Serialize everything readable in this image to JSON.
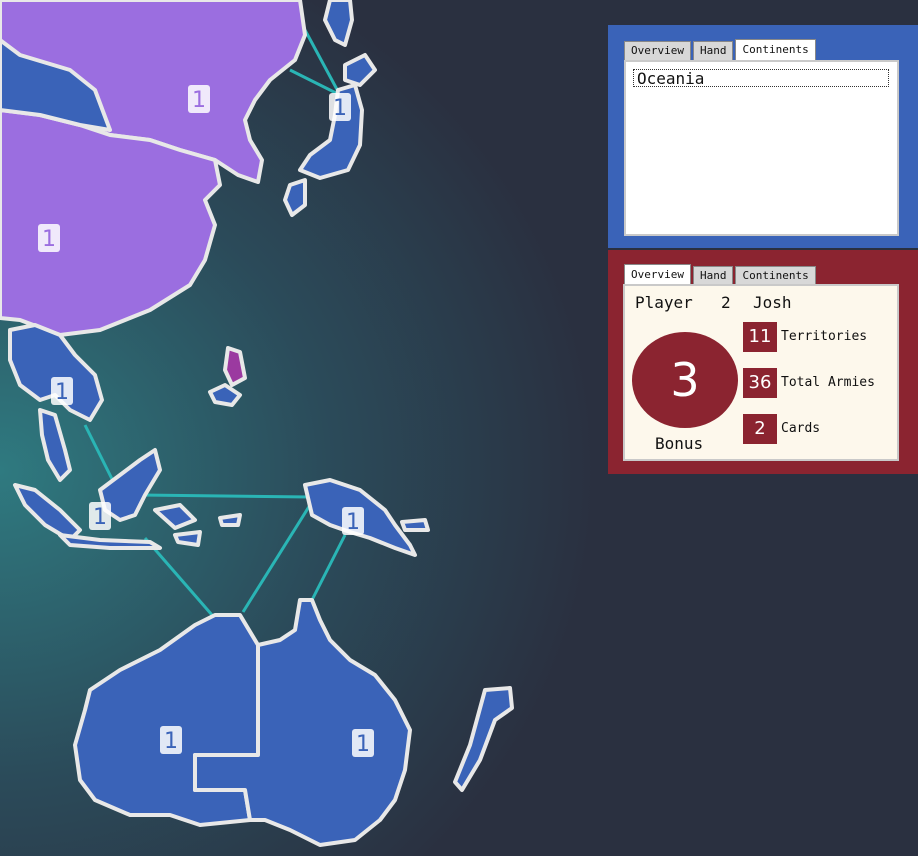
{
  "map": {
    "labels": {
      "north_china": "1",
      "china": "1",
      "japan": "1",
      "siam": "1",
      "indonesia": "1",
      "new_guinea": "1",
      "western_australia": "1",
      "eastern_australia": "1"
    },
    "colors": {
      "ocean_dark": "#2a3040",
      "ocean_teal": "#2f6c75",
      "asia_purple": "#9b6ee0",
      "player_blue": "#3a63b8",
      "connection": "#2ab5b5"
    }
  },
  "continents_panel": {
    "tabs": [
      "Overview",
      "Hand",
      "Continents"
    ],
    "active_tab": "Continents",
    "items": [
      "Oceania"
    ]
  },
  "player_panel": {
    "tabs": [
      "Overview",
      "Hand",
      "Continents"
    ],
    "active_tab": "Overview",
    "player_word": "Player",
    "player_number": "2",
    "player_name": "Josh",
    "bonus_value": "3",
    "bonus_label": "Bonus",
    "stats": [
      {
        "value": "11",
        "label": "Territories"
      },
      {
        "value": "36",
        "label": "Total Armies"
      },
      {
        "value": "2",
        "label": "Cards"
      }
    ],
    "accent": "#8b2430"
  }
}
